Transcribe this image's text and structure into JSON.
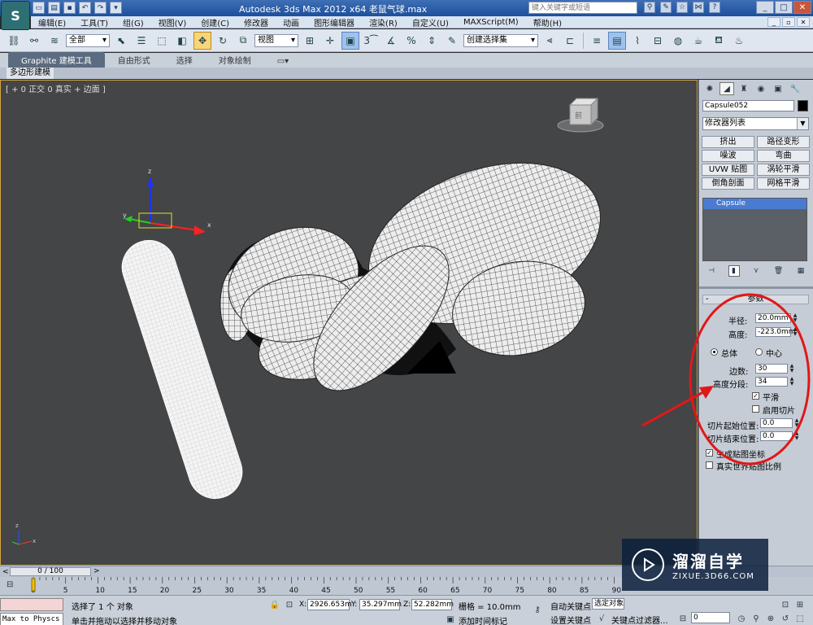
{
  "titlebar": {
    "title": "Autodesk 3ds Max  2012 x64     老鼠气球.max",
    "search_placeholder": "键入关键字或短语",
    "logo_text": "S"
  },
  "menu": {
    "items": [
      "编辑(E)",
      "工具(T)",
      "组(G)",
      "视图(V)",
      "创建(C)",
      "修改器",
      "动画",
      "图形编辑器",
      "渲染(R)",
      "自定义(U)",
      "MAXScript(M)",
      "帮助(H)"
    ]
  },
  "toolbar": {
    "selection_filter": "全部",
    "coordinate_system": "视图",
    "named_selection": "创建选择集"
  },
  "ribbon": {
    "tabs": [
      "Graphite 建模工具",
      "自由形式",
      "选择",
      "对象绘制"
    ],
    "subtab": "多边形建模"
  },
  "viewport": {
    "label": "[ + 0 正交 0 真实 + 边面 ]",
    "viewcube_label": "前"
  },
  "command_panel": {
    "object_name": "Capsule052",
    "modifier_list": "修改器列表",
    "modifier_buttons": [
      "挤出",
      "路径变形",
      "噪波",
      "弯曲",
      "UVW 贴图",
      "涡轮平滑",
      "倒角剖面",
      "网格平滑"
    ],
    "stack_item": "Capsule",
    "params": {
      "header": "参数",
      "radius_label": "半径:",
      "radius_value": "20.0mm",
      "height_label": "高度:",
      "height_value": "-223.0mm",
      "overall_label": "总体",
      "center_label": "中心",
      "sides_label": "边数:",
      "sides_value": "30",
      "height_segs_label": "高度分段:",
      "height_segs_value": "34",
      "smooth_label": "平滑",
      "slice_on_label": "启用切片",
      "slice_from_label": "切片起始位置:",
      "slice_from_value": "0.0",
      "slice_to_label": "切片结束位置:",
      "slice_to_value": "0.0",
      "gen_map_label": "生成贴图坐标",
      "real_world_label": "真实世界贴图比例"
    }
  },
  "timeline": {
    "slider_text": "0 / 100",
    "ticks": [
      "0",
      "5",
      "10",
      "15",
      "20",
      "25",
      "30",
      "35",
      "40",
      "45",
      "50",
      "55",
      "60",
      "65",
      "70",
      "75",
      "80",
      "85",
      "90"
    ]
  },
  "status": {
    "maxscript_text": "Max to Physcs (",
    "selected_text": "选择了 1 个 对象",
    "prompt_text": "单击并拖动以选择并移动对象",
    "x_label": "X:",
    "x_value": "2926.653m",
    "y_label": "Y:",
    "y_value": "35.297mm",
    "z_label": "Z:",
    "z_value": "52.282mm",
    "grid_text": "栅格 = 10.0mm",
    "auto_key": "自动关键点",
    "set_key": "设置关键点",
    "selected_obj": "选定对象",
    "add_time_tag": "添加时间标记",
    "key_filters": "关键点过滤器...",
    "frame_value": "0"
  },
  "watermark": {
    "title": "溜溜自学",
    "url": "ZIXUE.3D66.COM"
  },
  "colors": {
    "annotation": "#e01818",
    "accent": "#4a7bd1",
    "viewport_bg": "#444546"
  }
}
